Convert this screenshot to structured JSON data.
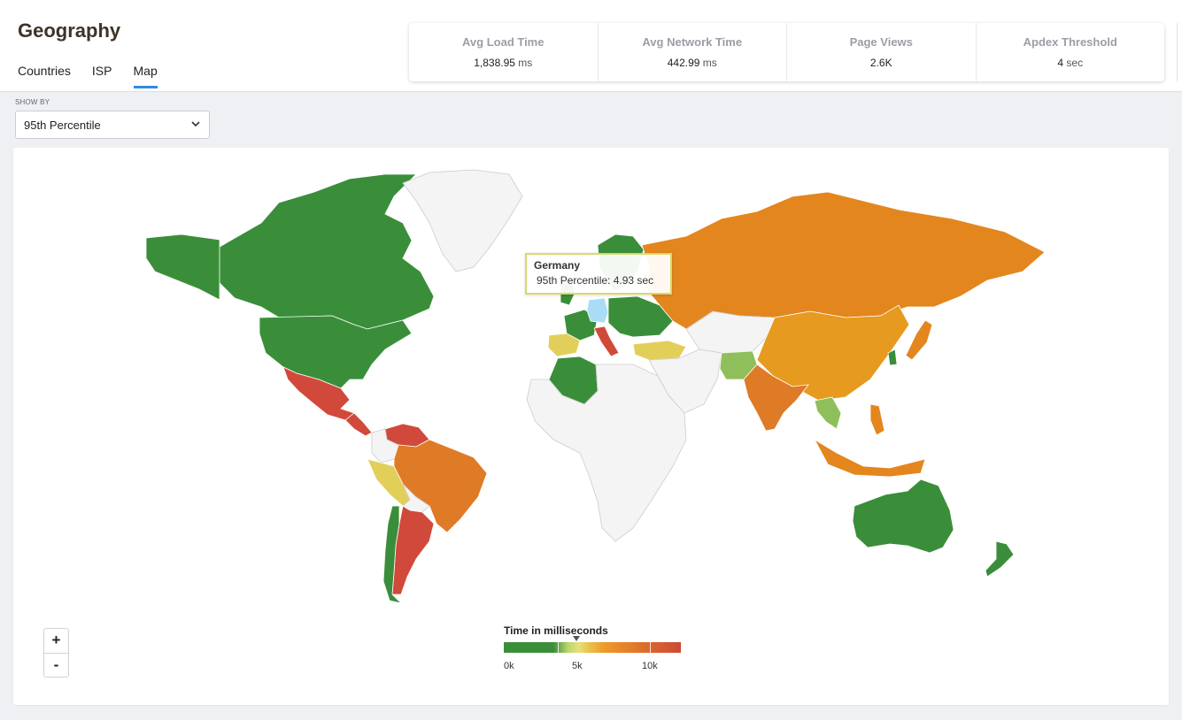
{
  "header": {
    "title": "Geography",
    "tabs": [
      {
        "label": "Countries",
        "active": false
      },
      {
        "label": "ISP",
        "active": false
      },
      {
        "label": "Map",
        "active": true
      }
    ]
  },
  "kpis": [
    {
      "label": "Avg Load Time",
      "value": "1,838.95",
      "unit": "ms"
    },
    {
      "label": "Avg Network Time",
      "value": "442.99",
      "unit": "ms"
    },
    {
      "label": "Page Views",
      "value": "2.6K",
      "unit": ""
    },
    {
      "label": "Apdex Threshold",
      "value": "4",
      "unit": "sec"
    }
  ],
  "show_by": {
    "label": "SHOW BY",
    "selected": "95th Percentile"
  },
  "map": {
    "tooltip": {
      "country": "Germany",
      "line": "95th Percentile: 4.93 sec"
    },
    "zoom": {
      "in": "+",
      "out": "-"
    },
    "legend": {
      "title": "Time in milliseconds",
      "labels": [
        "0k",
        "5k",
        "10k"
      ]
    },
    "colors": {
      "green": "#3a8e3a",
      "light_green": "#8fbf5a",
      "yellow": "#e2cf5a",
      "orange": "#e3861e",
      "dark_orange": "#df7a27",
      "red": "#d1493a",
      "no_data": "#f4f4f4",
      "highlight": "#a9ddf5"
    }
  }
}
